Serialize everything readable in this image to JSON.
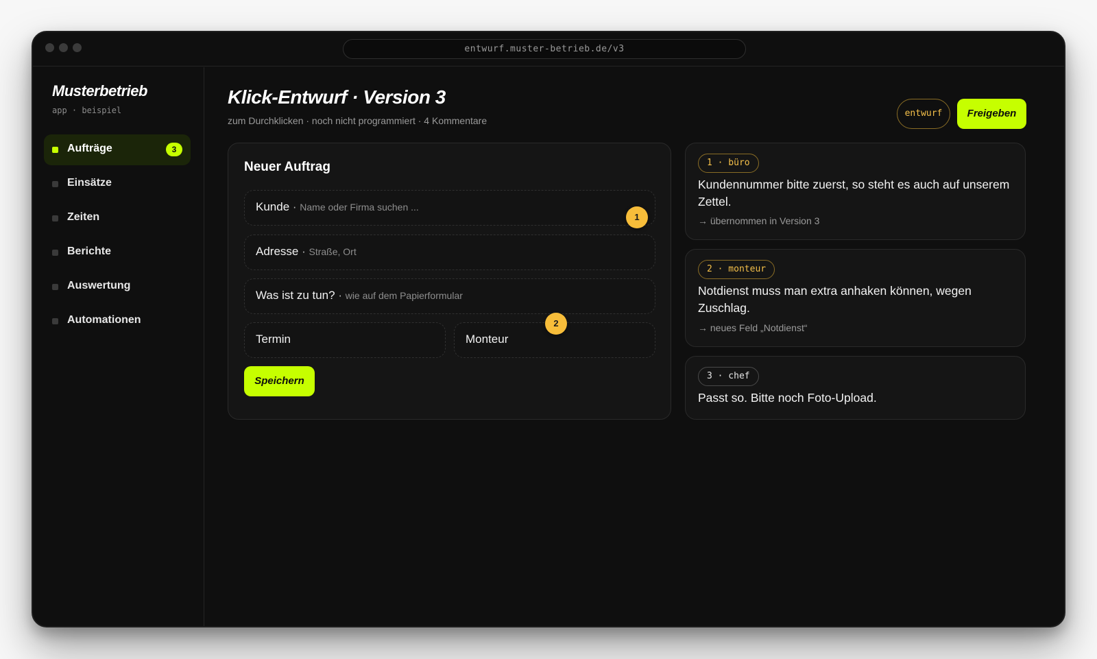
{
  "browser": {
    "url": "entwurf.muster-betrieb.de/v3"
  },
  "sidebar": {
    "brand": "Musterbetrieb",
    "brand_sub": "app · beispiel",
    "items": [
      {
        "label": "Aufträge",
        "badge": "3",
        "active": true
      },
      {
        "label": "Einsätze"
      },
      {
        "label": "Zeiten"
      },
      {
        "label": "Berichte"
      },
      {
        "label": "Auswertung"
      },
      {
        "label": "Automationen"
      }
    ]
  },
  "header": {
    "title": "Klick-Entwurf · Version 3",
    "subtitle": "zum Durchklicken · noch nicht programmiert · 4 Kommentare",
    "status_tag": "entwurf",
    "approve_label": "Freigeben"
  },
  "form": {
    "title": "Neuer Auftrag",
    "fields": [
      {
        "label": "Kunde",
        "separator": " · ",
        "hint": "Name oder Firma suchen ..."
      },
      {
        "label": "Adresse",
        "separator": " · ",
        "hint": "Straße, Ort"
      },
      {
        "label": "Was ist zu tun?",
        "separator": " · ",
        "hint": "wie auf dem Papierformular"
      },
      {
        "label": "Termin"
      },
      {
        "label": "Monteur"
      }
    ],
    "markers": [
      "1",
      "2"
    ],
    "save_label": "Speichern"
  },
  "comments": [
    {
      "tag": "1 · büro",
      "text": "Kundennummer bitte zuerst, so steht es auch auf unserem Zettel.",
      "note": "→ übernommen in Version 3"
    },
    {
      "tag": "2 · monteur",
      "text": "Notdienst muss man extra anhaken können, wegen Zuschlag.",
      "note": "→ neues Feld „Notdienst“"
    },
    {
      "tag": "3 · chef",
      "text": "Passt so. Bitte noch Foto-Upload."
    }
  ],
  "colors": {
    "accent": "#c6ff00",
    "marker": "#f7bd3a",
    "tag": "#f5c04a",
    "background": "#0f0f0f"
  }
}
